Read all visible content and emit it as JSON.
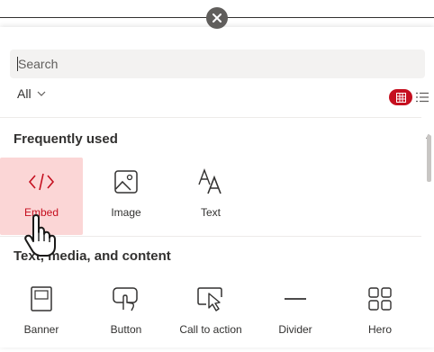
{
  "close": {
    "icon": "close-icon"
  },
  "search": {
    "placeholder": "Search"
  },
  "filter": {
    "label": "All"
  },
  "view": {
    "grid_icon": "grid-icon",
    "list_icon": "list-icon"
  },
  "sections": {
    "frequent": {
      "title": "Frequently used",
      "items": [
        {
          "label": "Embed",
          "icon": "code-icon",
          "selected": true
        },
        {
          "label": "Image",
          "icon": "image-icon"
        },
        {
          "label": "Text",
          "icon": "text-icon"
        }
      ]
    },
    "content": {
      "title": "Text, media, and content",
      "items": [
        {
          "label": "Banner",
          "icon": "banner-icon"
        },
        {
          "label": "Button",
          "icon": "button-icon"
        },
        {
          "label": "Call to action",
          "icon": "call-to-action-icon"
        },
        {
          "label": "Divider",
          "icon": "divider-icon"
        },
        {
          "label": "Hero",
          "icon": "hero-icon"
        }
      ]
    }
  },
  "colors": {
    "accent": "#c50f1f",
    "selected_bg": "#fbd6d6",
    "text": "#323130"
  }
}
